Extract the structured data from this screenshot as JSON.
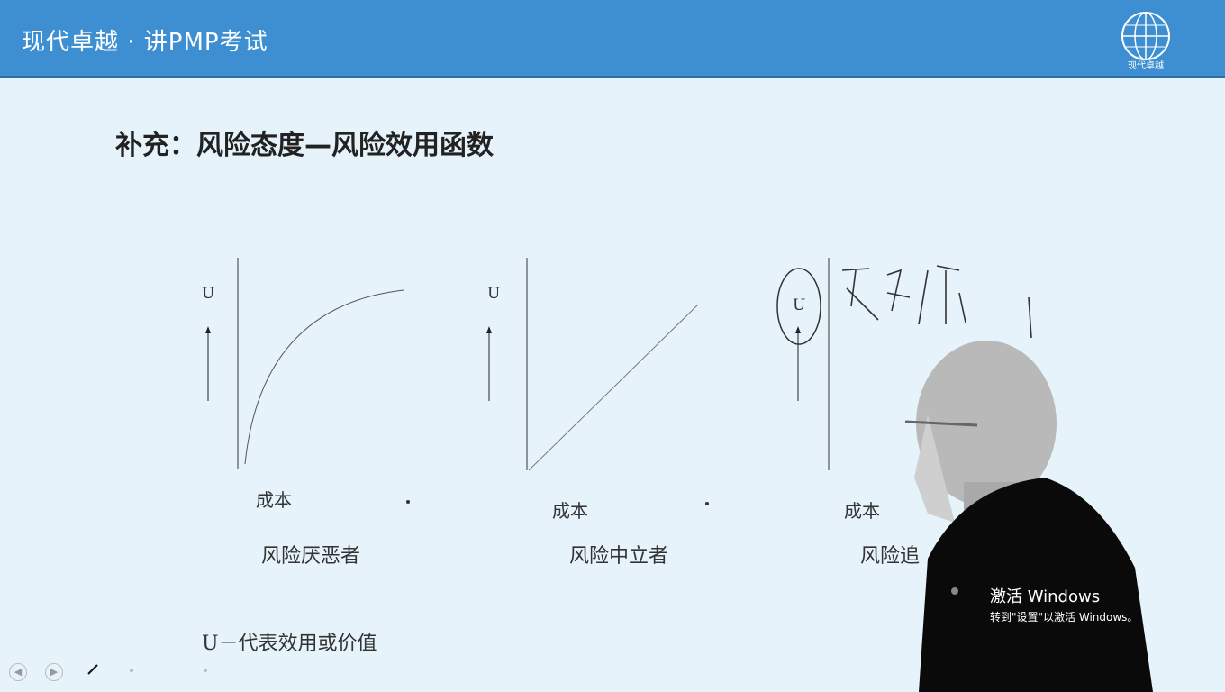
{
  "header": {
    "title": "现代卓越 · 讲PMP考试",
    "logo_text": "现代卓越"
  },
  "slide": {
    "title": "补充：风险态度—风险效用函数",
    "graphs": [
      {
        "u_label": "U",
        "x_label": "成本",
        "caption": "风险厌恶者"
      },
      {
        "u_label": "U",
        "x_label": "成本",
        "caption": "风险中立者"
      },
      {
        "u_label": "U",
        "x_label": "成本",
        "caption": "风险追"
      }
    ],
    "annotation_text": "效价",
    "note": "U－代表效用或价值"
  },
  "windows_watermark": {
    "line1": "激活 Windows",
    "line2": "转到\"设置\"以激活 Windows。"
  },
  "toolbar": {
    "icons": [
      "back-icon",
      "forward-icon",
      "pen-icon",
      "dot-icon",
      "dot-icon"
    ]
  }
}
